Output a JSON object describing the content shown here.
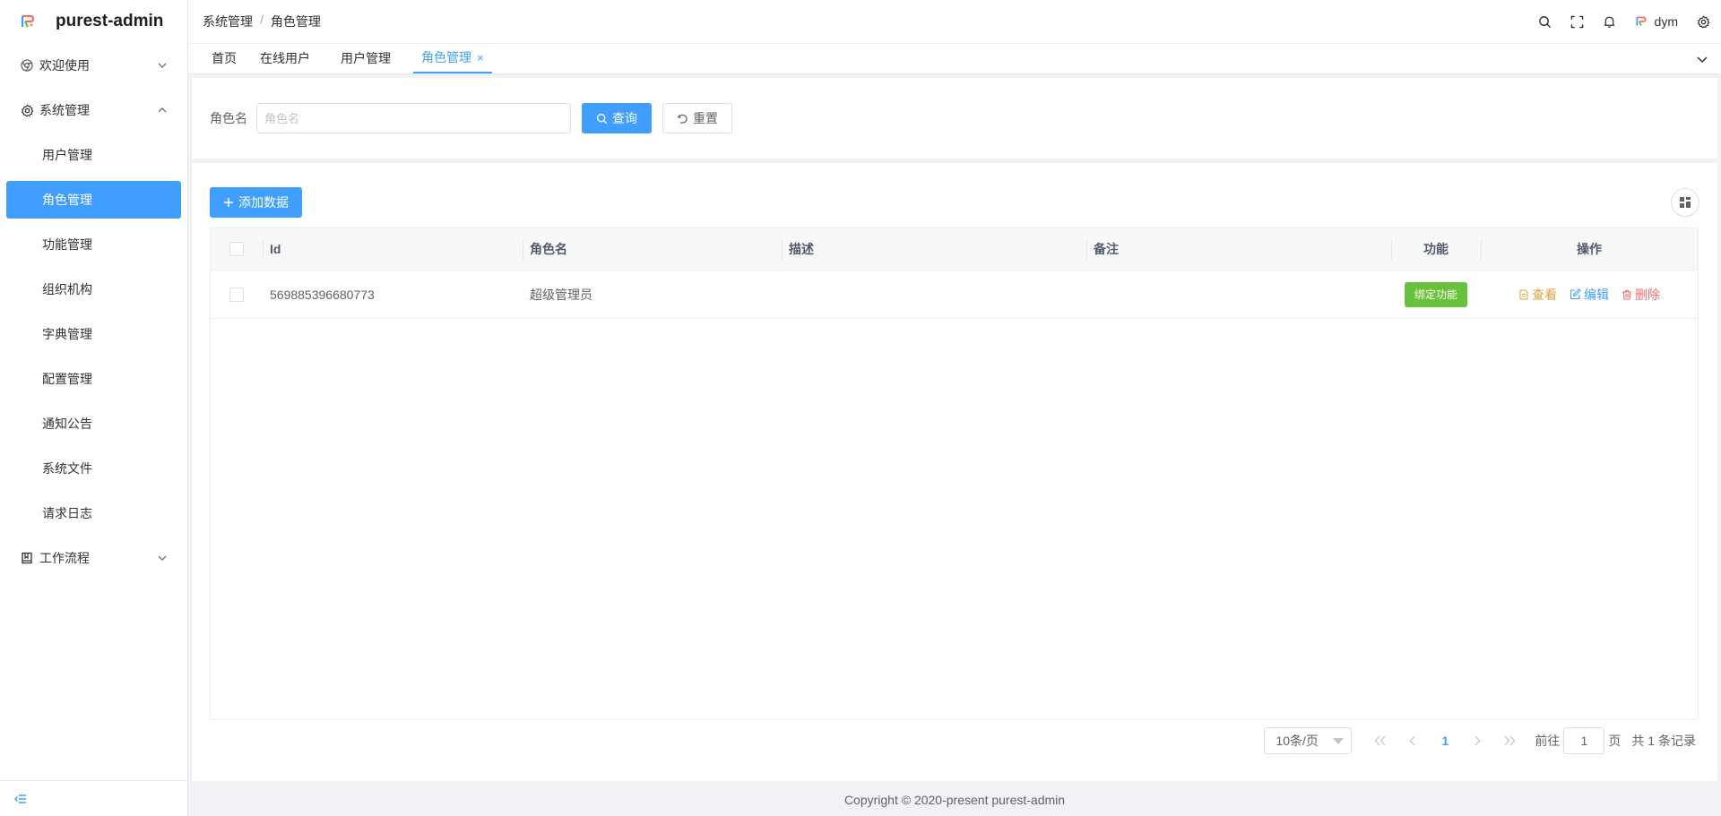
{
  "app": {
    "title": "purest-admin"
  },
  "sidebar": {
    "items": [
      {
        "label": "欢迎使用",
        "icon": "chrome-icon",
        "expanded": false
      },
      {
        "label": "系统管理",
        "icon": "gear-icon",
        "expanded": true
      },
      {
        "label": "工作流程",
        "icon": "book-icon",
        "expanded": false
      }
    ],
    "sub_items": [
      {
        "label": "用户管理"
      },
      {
        "label": "角色管理",
        "active": true
      },
      {
        "label": "功能管理"
      },
      {
        "label": "组织机构"
      },
      {
        "label": "字典管理"
      },
      {
        "label": "配置管理"
      },
      {
        "label": "通知公告"
      },
      {
        "label": "系统文件"
      },
      {
        "label": "请求日志"
      }
    ]
  },
  "header": {
    "breadcrumb": [
      "系统管理",
      "角色管理"
    ],
    "separator": "/",
    "username": "dym"
  },
  "tabs": [
    {
      "label": "首页"
    },
    {
      "label": "在线用户"
    },
    {
      "label": "用户管理"
    },
    {
      "label": "角色管理",
      "active": true,
      "close": "×"
    }
  ],
  "search": {
    "label": "角色名",
    "placeholder": "角色名",
    "value": "",
    "query_label": "查询",
    "reset_label": "重置"
  },
  "toolbar": {
    "add_label": "添加数据"
  },
  "table": {
    "columns": [
      "Id",
      "角色名",
      "描述",
      "备注",
      "功能",
      "操作"
    ],
    "rows": [
      {
        "id": "569885396680773",
        "name": "超级管理员",
        "description": "",
        "remark": "",
        "func_label": "绑定功能",
        "view_label": "查看",
        "edit_label": "编辑",
        "delete_label": "删除"
      }
    ]
  },
  "pagination": {
    "page_size": "10条/页",
    "current": "1",
    "goto_prefix": "前往",
    "goto_value": "1",
    "goto_suffix": "页",
    "total_text": "共 1 条记录"
  },
  "footer": {
    "copyright": "Copyright © 2020-present purest-admin"
  },
  "colors": {
    "primary": "#409eff",
    "success": "#67c23a",
    "warning": "#e6a23c",
    "danger": "#f56c6c"
  }
}
